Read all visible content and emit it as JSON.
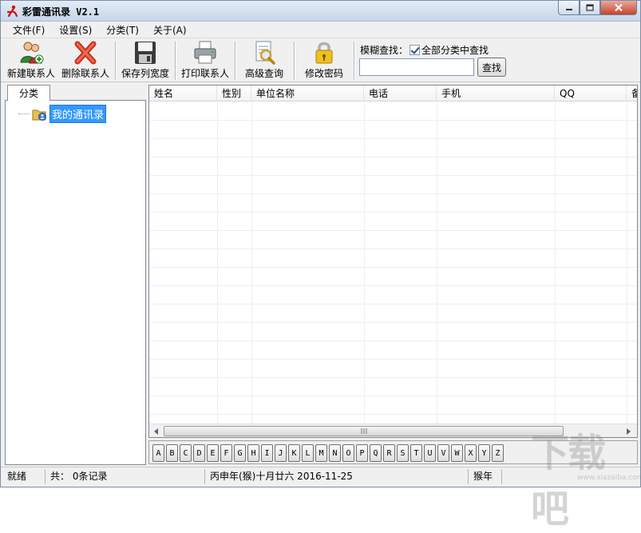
{
  "window": {
    "title": "彩雷通讯录 V2.1",
    "buttons": {
      "minimize": "▭",
      "maximize": "□",
      "close": "✕"
    }
  },
  "menu": [
    "文件(F)",
    "设置(S)",
    "分类(T)",
    "关于(A)"
  ],
  "toolbar": {
    "buttons": [
      {
        "label": "新建联系人",
        "icon": "add-contact-icon"
      },
      {
        "label": "删除联系人",
        "icon": "delete-x-icon"
      },
      {
        "label": "保存列宽度",
        "icon": "floppy-disk-icon"
      },
      {
        "label": "打印联系人",
        "icon": "printer-icon"
      },
      {
        "label": "高级查询",
        "icon": "magnifier-document-icon"
      },
      {
        "label": "修改密码",
        "icon": "padlock-icon"
      }
    ],
    "search": {
      "label": "模糊查找：",
      "checkbox_label": "全部分类中查找",
      "checkbox_checked": true,
      "input_value": "",
      "button_label": "查找"
    }
  },
  "sidebar": {
    "tab_label": "分类",
    "tree": [
      {
        "label": "我的通讯录",
        "icon": "address-book-icon",
        "selected": true
      }
    ]
  },
  "grid": {
    "columns": [
      "姓名",
      "性别",
      "单位名称",
      "电话",
      "手机",
      "QQ",
      "备"
    ],
    "rows": []
  },
  "alphabet": [
    "A",
    "B",
    "C",
    "D",
    "E",
    "F",
    "G",
    "H",
    "I",
    "J",
    "K",
    "L",
    "M",
    "N",
    "O",
    "P",
    "Q",
    "R",
    "S",
    "T",
    "U",
    "V",
    "W",
    "X",
    "Y",
    "Z"
  ],
  "status": {
    "ready": "就绪",
    "count": "共： 0条记录",
    "date": "丙申年(猴)十月廿六 2016-11-25",
    "zodiac": "猴年"
  },
  "watermark": {
    "main": "下载吧",
    "sub": "www.xiazaiba.com"
  },
  "colors": {
    "selection": "#3399ff",
    "title_gradient_top": "#e3ecf7",
    "close_button": "#c7432c"
  }
}
